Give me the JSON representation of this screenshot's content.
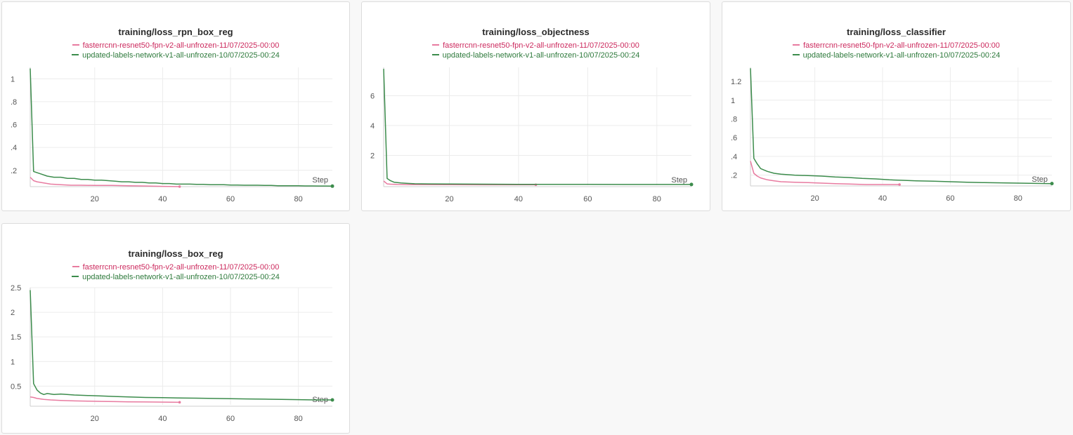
{
  "series_names": [
    "fasterrcnn-resnet50-fpn-v2-all-unfrozen-11/07/2025-00:00",
    "updated-labels-network-v1-all-unfrozen-10/07/2025-00:24"
  ],
  "colors": {
    "pink": "#e87ba0",
    "pink_text": "#cc2a5e",
    "green": "#3c8c4c",
    "green_text": "#2e7a3c"
  },
  "step_label": "Step",
  "chart_data": [
    {
      "type": "line",
      "title": "training/loss_rpn_box_reg",
      "xlabel": "Step",
      "ylabel": "",
      "xlim": [
        1,
        90
      ],
      "ylim": [
        0.07,
        1.1
      ],
      "x_ticks": [
        20,
        40,
        60,
        80
      ],
      "y_ticks": [
        0.2,
        0.4,
        0.6,
        0.8,
        1
      ],
      "y_tick_labels": [
        ".2",
        ".4",
        ".6",
        ".8",
        "1"
      ],
      "grid": true,
      "legend": "top-center",
      "series": [
        {
          "name": "fasterrcnn-resnet50-fpn-v2-all-unfrozen-11/07/2025-00:00",
          "x": [
            1,
            2,
            3,
            5,
            7,
            10,
            13,
            16,
            20,
            25,
            30,
            35,
            40,
            45
          ],
          "y": [
            0.14,
            0.11,
            0.1,
            0.09,
            0.08,
            0.075,
            0.07,
            0.07,
            0.068,
            0.068,
            0.065,
            0.063,
            0.06,
            0.058
          ]
        },
        {
          "name": "updated-labels-network-v1-all-unfrozen-10/07/2025-00:24",
          "x": [
            1,
            2,
            4,
            6,
            8,
            10,
            12,
            14,
            16,
            18,
            20,
            22,
            24,
            26,
            28,
            30,
            32,
            34,
            36,
            38,
            40,
            42,
            44,
            46,
            48,
            50,
            52,
            54,
            56,
            58,
            60,
            62,
            64,
            66,
            68,
            70,
            72,
            74,
            76,
            78,
            80,
            82,
            84,
            86,
            88,
            90
          ],
          "y": [
            1.09,
            0.19,
            0.17,
            0.15,
            0.14,
            0.14,
            0.13,
            0.13,
            0.12,
            0.12,
            0.115,
            0.115,
            0.11,
            0.105,
            0.1,
            0.1,
            0.095,
            0.095,
            0.09,
            0.09,
            0.085,
            0.085,
            0.08,
            0.08,
            0.08,
            0.078,
            0.078,
            0.075,
            0.075,
            0.075,
            0.072,
            0.072,
            0.07,
            0.07,
            0.07,
            0.068,
            0.068,
            0.066,
            0.066,
            0.065,
            0.065,
            0.064,
            0.064,
            0.063,
            0.063,
            0.062
          ]
        }
      ]
    },
    {
      "type": "line",
      "title": "training/loss_objectness",
      "xlabel": "Step",
      "ylabel": "",
      "xlim": [
        1,
        90
      ],
      "ylim": [
        0,
        7.9
      ],
      "x_ticks": [
        20,
        40,
        60,
        80
      ],
      "y_ticks": [
        2,
        4,
        6
      ],
      "y_tick_labels": [
        "2",
        "4",
        "6"
      ],
      "grid": true,
      "legend": "top-center",
      "series": [
        {
          "name": "fasterrcnn-resnet50-fpn-v2-all-unfrozen-11/07/2025-00:00",
          "x": [
            1,
            2,
            3,
            5,
            8,
            12,
            20,
            30,
            40,
            45
          ],
          "y": [
            0.28,
            0.09,
            0.07,
            0.05,
            0.04,
            0.04,
            0.035,
            0.03,
            0.03,
            0.03
          ]
        },
        {
          "name": "updated-labels-network-v1-all-unfrozen-10/07/2025-00:24",
          "x": [
            1,
            2,
            3,
            4,
            6,
            8,
            10,
            14,
            20,
            30,
            40,
            50,
            60,
            70,
            80,
            90
          ],
          "y": [
            7.8,
            0.45,
            0.3,
            0.2,
            0.15,
            0.12,
            0.1,
            0.09,
            0.08,
            0.07,
            0.06,
            0.06,
            0.055,
            0.05,
            0.05,
            0.05
          ]
        }
      ]
    },
    {
      "type": "line",
      "title": "training/loss_classifier",
      "xlabel": "Step",
      "ylabel": "",
      "xlim": [
        1,
        90
      ],
      "ylim": [
        0.1,
        1.35
      ],
      "x_ticks": [
        20,
        40,
        60,
        80
      ],
      "y_ticks": [
        0.2,
        0.4,
        0.6,
        0.8,
        1,
        1.2
      ],
      "y_tick_labels": [
        ".2",
        ".4",
        ".6",
        ".8",
        "1",
        "1.2"
      ],
      "grid": true,
      "legend": "top-center",
      "series": [
        {
          "name": "fasterrcnn-resnet50-fpn-v2-all-unfrozen-11/07/2025-00:00",
          "x": [
            1,
            2,
            3,
            4,
            6,
            8,
            10,
            14,
            18,
            22,
            26,
            30,
            35,
            40,
            45
          ],
          "y": [
            0.35,
            0.22,
            0.19,
            0.17,
            0.15,
            0.14,
            0.13,
            0.125,
            0.12,
            0.115,
            0.11,
            0.105,
            0.1,
            0.1,
            0.1
          ]
        },
        {
          "name": "updated-labels-network-v1-all-unfrozen-10/07/2025-00:24",
          "x": [
            1,
            2,
            3,
            4,
            6,
            8,
            10,
            14,
            18,
            22,
            26,
            30,
            34,
            38,
            42,
            46,
            50,
            55,
            60,
            65,
            70,
            75,
            80,
            85,
            90
          ],
          "y": [
            1.34,
            0.38,
            0.32,
            0.27,
            0.24,
            0.22,
            0.21,
            0.2,
            0.195,
            0.19,
            0.18,
            0.175,
            0.165,
            0.16,
            0.15,
            0.145,
            0.14,
            0.135,
            0.13,
            0.125,
            0.12,
            0.118,
            0.115,
            0.112,
            0.11
          ]
        }
      ]
    },
    {
      "type": "line",
      "title": "training/loss_box_reg",
      "xlabel": "Step",
      "ylabel": "",
      "xlim": [
        1,
        90
      ],
      "ylim": [
        0.12,
        2.5
      ],
      "x_ticks": [
        20,
        40,
        60,
        80
      ],
      "y_ticks": [
        0.5,
        1,
        1.5,
        2,
        2.5
      ],
      "y_tick_labels": [
        "0.5",
        "1",
        "1.5",
        "2",
        "2.5"
      ],
      "grid": true,
      "legend": "top-center",
      "series": [
        {
          "name": "fasterrcnn-resnet50-fpn-v2-all-unfrozen-11/07/2025-00:00",
          "x": [
            1,
            2,
            3,
            5,
            7,
            10,
            14,
            18,
            22,
            26,
            30,
            35,
            40,
            45
          ],
          "y": [
            0.28,
            0.27,
            0.25,
            0.23,
            0.22,
            0.21,
            0.2,
            0.195,
            0.19,
            0.185,
            0.18,
            0.178,
            0.175,
            0.172
          ]
        },
        {
          "name": "updated-labels-network-v1-all-unfrozen-10/07/2025-00:24",
          "x": [
            1,
            2,
            3,
            4,
            5,
            6,
            8,
            10,
            14,
            18,
            22,
            26,
            30,
            35,
            40,
            45,
            50,
            55,
            60,
            65,
            70,
            75,
            80,
            85,
            90
          ],
          "y": [
            2.45,
            0.55,
            0.42,
            0.36,
            0.33,
            0.35,
            0.33,
            0.34,
            0.32,
            0.31,
            0.3,
            0.29,
            0.28,
            0.27,
            0.265,
            0.26,
            0.255,
            0.25,
            0.245,
            0.24,
            0.235,
            0.23,
            0.225,
            0.22,
            0.22
          ]
        }
      ]
    }
  ]
}
